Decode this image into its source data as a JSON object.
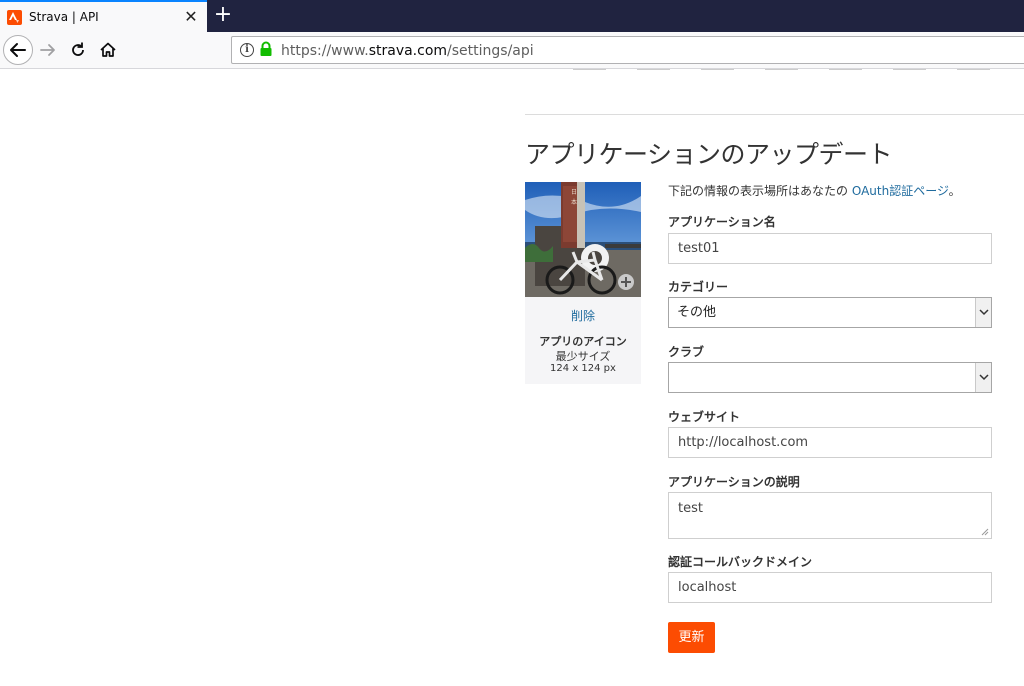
{
  "browser": {
    "tab_title": "Strava | API",
    "tab_close": "✕",
    "new_tab": "+",
    "url_prefix": "https://www.",
    "url_host": "strava.com",
    "url_path": "/settings/api"
  },
  "colors": {
    "accent": "#fc4c02",
    "link": "#1f6b9e",
    "tabstrip": "#202340"
  },
  "page": {
    "title": "アプリケーションのアップデート",
    "intro_text": "下記の情報の表示場所はあなたの ",
    "intro_link": "OAuth認証ページ",
    "intro_end": "。"
  },
  "icon_panel": {
    "delete_label": "削除",
    "heading": "アプリのアイコン",
    "min_size_label": "最少サイズ",
    "size": "124 x 124 px"
  },
  "form": {
    "app_name_label": "アプリケーション名",
    "app_name_value": "test01",
    "category_label": "カテゴリー",
    "category_value": "その他",
    "club_label": "クラブ",
    "club_value": "",
    "website_label": "ウェブサイト",
    "website_value": "http://localhost.com",
    "description_label": "アプリケーションの説明",
    "description_value": "test",
    "callback_label": "認証コールバックドメイン",
    "callback_value": "localhost",
    "submit_label": "更新"
  }
}
